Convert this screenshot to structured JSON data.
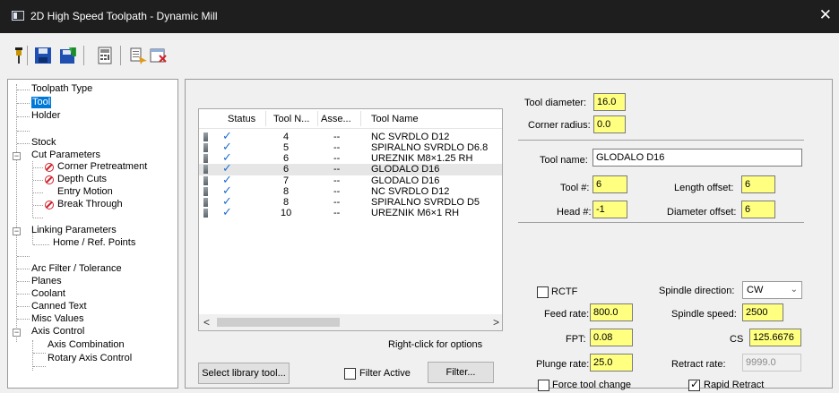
{
  "window": {
    "title": "2D High Speed Toolpath - Dynamic Mill",
    "close_glyph": "✕"
  },
  "toolbar": {
    "icons": [
      "pin-icon",
      "save-icon",
      "save-all-icon",
      "calculator-icon",
      "view-icon",
      "close-doc-icon"
    ]
  },
  "tree": {
    "items": [
      "Toolpath Type",
      "Tool",
      "Holder",
      "Stock",
      "Cut Parameters",
      "Corner Pretreatment",
      "Depth Cuts",
      "Entry Motion",
      "Break Through",
      "Linking Parameters",
      "Home / Ref. Points",
      "Arc Filter / Tolerance",
      "Planes",
      "Coolant",
      "Canned Text",
      "Misc Values",
      "Axis Control",
      "Axis Combination",
      "Rotary Axis Control"
    ],
    "selected": "Tool",
    "expander_minus": "−"
  },
  "tool_table": {
    "columns": [
      "Status",
      "Tool N...",
      "Asse...",
      "Tool Name"
    ],
    "rows": [
      {
        "check": "✓",
        "num": "4",
        "asse": "--",
        "name": "NC SVRDLO  D12"
      },
      {
        "check": "✓",
        "num": "5",
        "asse": "--",
        "name": "SPIRALNO SVRDLO D6.8"
      },
      {
        "check": "✓",
        "num": "6",
        "asse": "--",
        "name": "UREZNIK M8×1.25 RH"
      },
      {
        "check": "✓",
        "num": "6",
        "asse": "--",
        "name": "GLODALO D16"
      },
      {
        "check": "✓",
        "num": "7",
        "asse": "--",
        "name": "GLODALO D16"
      },
      {
        "check": "✓",
        "num": "8",
        "asse": "--",
        "name": "NC SVRDLO D12"
      },
      {
        "check": "✓",
        "num": "8",
        "asse": "--",
        "name": "SPIRALNO SVRDLO D5"
      },
      {
        "check": "✓",
        "num": "10",
        "asse": "--",
        "name": "UREZNIK M6×1 RH"
      }
    ],
    "selected_row": 3,
    "scroll_left": "<",
    "scroll_right": ">"
  },
  "hint": "Right-click for options",
  "buttons": {
    "select_library": "Select library tool...",
    "filter_active": "Filter Active",
    "filter_active_checked": false,
    "filter": "Filter..."
  },
  "tool_params": {
    "tool_diameter_label": "Tool diameter:",
    "tool_diameter": "16.0",
    "corner_radius_label": "Corner radius:",
    "corner_radius": "0.0",
    "tool_name_label": "Tool name:",
    "tool_name": "GLODALO D16",
    "tool_num_label": "Tool #:",
    "tool_num": "6",
    "length_offset_label": "Length offset:",
    "length_offset": "6",
    "head_num_label": "Head #:",
    "head_num": "-1",
    "diameter_offset_label": "Diameter offset:",
    "diameter_offset": "6"
  },
  "feeds": {
    "rctf_label": "RCTF",
    "rctf_checked": false,
    "spindle_direction_label": "Spindle direction:",
    "spindle_direction": "CW",
    "feed_rate_label": "Feed rate:",
    "feed_rate": "800.0",
    "spindle_speed_label": "Spindle speed:",
    "spindle_speed": "2500",
    "fpt_label": "FPT:",
    "fpt": "0.08",
    "cs_label": "CS",
    "cs": "125.6676",
    "plunge_rate_label": "Plunge rate:",
    "plunge_rate": "25.0",
    "retract_rate_label": "Retract rate:",
    "retract_rate": "9999.0",
    "force_tool_change_label": "Force tool change",
    "force_tool_change_checked": false,
    "rapid_retract_label": "Rapid Retract",
    "rapid_retract_checked": true
  },
  "colors": {
    "field_highlight": "#ffff80",
    "selection": "#0078d7",
    "check": "#1f6fd0",
    "error": "#d0202a"
  }
}
